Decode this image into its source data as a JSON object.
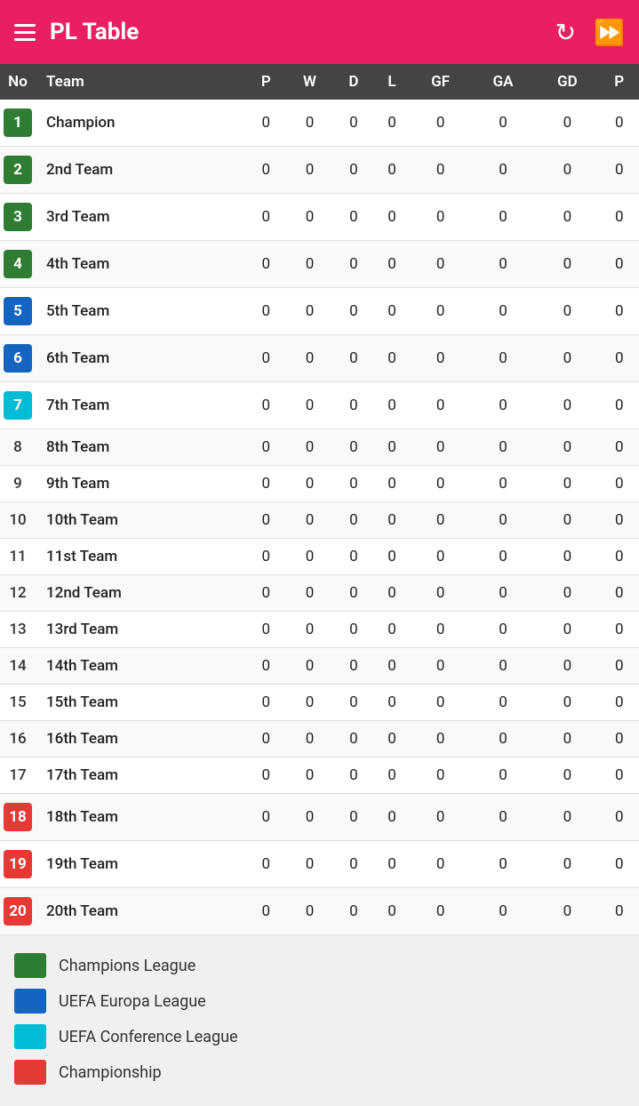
{
  "header": {
    "title": "PL Table",
    "hamburger_label": "Menu",
    "refresh_label": "Refresh",
    "fast_forward_label": "Fast Forward"
  },
  "table": {
    "columns": [
      "No",
      "Team",
      "P",
      "W",
      "D",
      "L",
      "GF",
      "GA",
      "GD",
      "P"
    ],
    "rows": [
      {
        "no": 1,
        "team": "Champion",
        "p": 0,
        "w": 0,
        "d": 0,
        "l": 0,
        "gf": 0,
        "ga": 0,
        "gd": 0,
        "pts": 0,
        "badge_color": "#2e7d32"
      },
      {
        "no": 2,
        "team": "2nd Team",
        "p": 0,
        "w": 0,
        "d": 0,
        "l": 0,
        "gf": 0,
        "ga": 0,
        "gd": 0,
        "pts": 0,
        "badge_color": "#2e7d32"
      },
      {
        "no": 3,
        "team": "3rd Team",
        "p": 0,
        "w": 0,
        "d": 0,
        "l": 0,
        "gf": 0,
        "ga": 0,
        "gd": 0,
        "pts": 0,
        "badge_color": "#2e7d32"
      },
      {
        "no": 4,
        "team": "4th Team",
        "p": 0,
        "w": 0,
        "d": 0,
        "l": 0,
        "gf": 0,
        "ga": 0,
        "gd": 0,
        "pts": 0,
        "badge_color": "#2e7d32"
      },
      {
        "no": 5,
        "team": "5th Team",
        "p": 0,
        "w": 0,
        "d": 0,
        "l": 0,
        "gf": 0,
        "ga": 0,
        "gd": 0,
        "pts": 0,
        "badge_color": "#1565c0"
      },
      {
        "no": 6,
        "team": "6th Team",
        "p": 0,
        "w": 0,
        "d": 0,
        "l": 0,
        "gf": 0,
        "ga": 0,
        "gd": 0,
        "pts": 0,
        "badge_color": "#1565c0"
      },
      {
        "no": 7,
        "team": "7th Team",
        "p": 0,
        "w": 0,
        "d": 0,
        "l": 0,
        "gf": 0,
        "ga": 0,
        "gd": 0,
        "pts": 0,
        "badge_color": "#00bcd4"
      },
      {
        "no": 8,
        "team": "8th Team",
        "p": 0,
        "w": 0,
        "d": 0,
        "l": 0,
        "gf": 0,
        "ga": 0,
        "gd": 0,
        "pts": 0,
        "badge_color": null
      },
      {
        "no": 9,
        "team": "9th Team",
        "p": 0,
        "w": 0,
        "d": 0,
        "l": 0,
        "gf": 0,
        "ga": 0,
        "gd": 0,
        "pts": 0,
        "badge_color": null
      },
      {
        "no": 10,
        "team": "10th Team",
        "p": 0,
        "w": 0,
        "d": 0,
        "l": 0,
        "gf": 0,
        "ga": 0,
        "gd": 0,
        "pts": 0,
        "badge_color": null
      },
      {
        "no": 11,
        "team": "11st Team",
        "p": 0,
        "w": 0,
        "d": 0,
        "l": 0,
        "gf": 0,
        "ga": 0,
        "gd": 0,
        "pts": 0,
        "badge_color": null
      },
      {
        "no": 12,
        "team": "12nd Team",
        "p": 0,
        "w": 0,
        "d": 0,
        "l": 0,
        "gf": 0,
        "ga": 0,
        "gd": 0,
        "pts": 0,
        "badge_color": null
      },
      {
        "no": 13,
        "team": "13rd Team",
        "p": 0,
        "w": 0,
        "d": 0,
        "l": 0,
        "gf": 0,
        "ga": 0,
        "gd": 0,
        "pts": 0,
        "badge_color": null
      },
      {
        "no": 14,
        "team": "14th Team",
        "p": 0,
        "w": 0,
        "d": 0,
        "l": 0,
        "gf": 0,
        "ga": 0,
        "gd": 0,
        "pts": 0,
        "badge_color": null
      },
      {
        "no": 15,
        "team": "15th Team",
        "p": 0,
        "w": 0,
        "d": 0,
        "l": 0,
        "gf": 0,
        "ga": 0,
        "gd": 0,
        "pts": 0,
        "badge_color": null
      },
      {
        "no": 16,
        "team": "16th Team",
        "p": 0,
        "w": 0,
        "d": 0,
        "l": 0,
        "gf": 0,
        "ga": 0,
        "gd": 0,
        "pts": 0,
        "badge_color": null
      },
      {
        "no": 17,
        "team": "17th Team",
        "p": 0,
        "w": 0,
        "d": 0,
        "l": 0,
        "gf": 0,
        "ga": 0,
        "gd": 0,
        "pts": 0,
        "badge_color": null
      },
      {
        "no": 18,
        "team": "18th Team",
        "p": 0,
        "w": 0,
        "d": 0,
        "l": 0,
        "gf": 0,
        "ga": 0,
        "gd": 0,
        "pts": 0,
        "badge_color": "#e53935"
      },
      {
        "no": 19,
        "team": "19th Team",
        "p": 0,
        "w": 0,
        "d": 0,
        "l": 0,
        "gf": 0,
        "ga": 0,
        "gd": 0,
        "pts": 0,
        "badge_color": "#e53935"
      },
      {
        "no": 20,
        "team": "20th Team",
        "p": 0,
        "w": 0,
        "d": 0,
        "l": 0,
        "gf": 0,
        "ga": 0,
        "gd": 0,
        "pts": 0,
        "badge_color": "#e53935"
      }
    ]
  },
  "legend": [
    {
      "color": "#2e7d32",
      "label": "Champions League"
    },
    {
      "color": "#1565c0",
      "label": "UEFA Europa League"
    },
    {
      "color": "#00bcd4",
      "label": "UEFA Conference League"
    },
    {
      "color": "#e53935",
      "label": "Championship"
    }
  ]
}
